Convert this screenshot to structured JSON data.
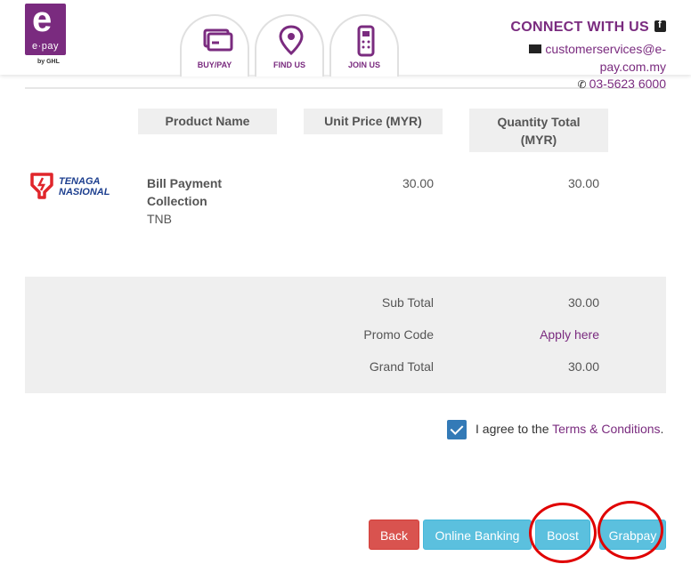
{
  "header": {
    "logo_word": "e·pay",
    "logo_by": "by GHL",
    "nav": [
      {
        "label": "BUY/PAY",
        "icon": "card-icon"
      },
      {
        "label": "FIND US",
        "icon": "location-pin-icon"
      },
      {
        "label": "JOIN US",
        "icon": "payment-terminal-icon"
      }
    ],
    "connect_title": "CONNECT WITH US",
    "email": "customerservices@e-pay.com.my",
    "phone": "03-5623 6000"
  },
  "table": {
    "columns": [
      "Product Name",
      "Unit Price (MYR)",
      "Quantity Total (MYR)"
    ],
    "row": {
      "logo_text_1": "TENAGA",
      "logo_text_2": "NASIONAL",
      "product_line_1": "Bill Payment",
      "product_line_2": "Collection",
      "product_sub": "TNB",
      "unit_price": "30.00",
      "quantity_total": "30.00"
    }
  },
  "totals": {
    "sub_total_label": "Sub Total",
    "sub_total_value": "30.00",
    "promo_label": "Promo Code",
    "promo_link": "Apply here",
    "grand_total_label": "Grand Total",
    "grand_total_value": "30.00"
  },
  "agree": {
    "checked": true,
    "text": "I agree to the ",
    "link": "Terms & Conditions",
    "suffix": "."
  },
  "buttons": {
    "back": "Back",
    "online_banking": "Online Banking",
    "boost": "Boost",
    "grabpay": "Grabpay"
  },
  "colors": {
    "brand_purple": "#7a2b7f",
    "back_red": "#d9534f",
    "button_blue": "#5bc0de",
    "highlight_red": "#e00000"
  }
}
